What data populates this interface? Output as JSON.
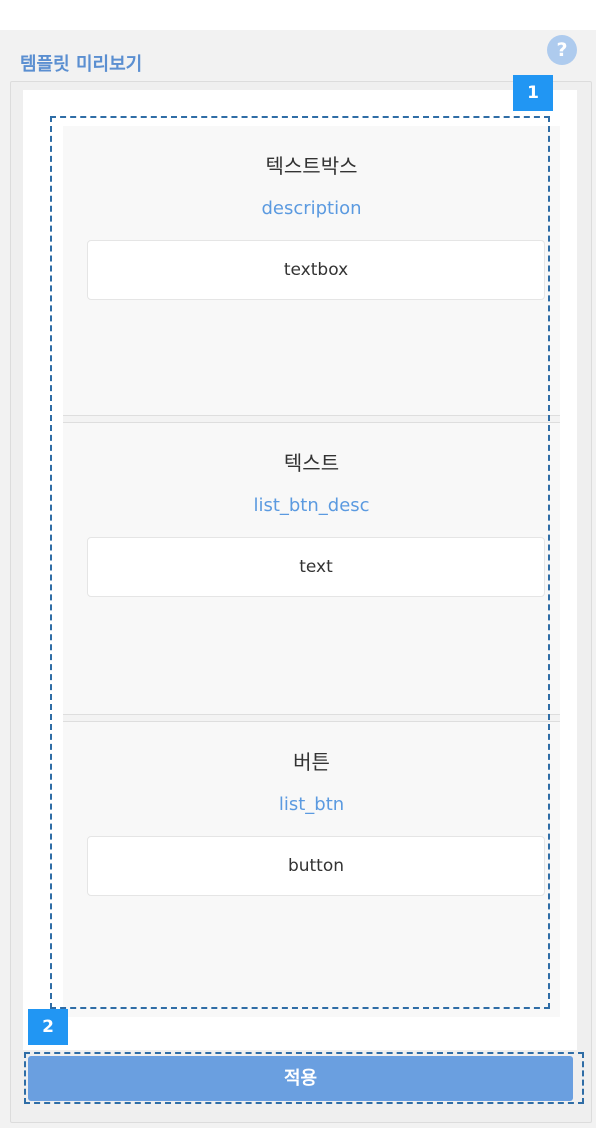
{
  "panel": {
    "title": "템플릿 미리보기",
    "help_icon": "question-mark-circle-icon",
    "help_symbol": "?"
  },
  "badges": [
    "1",
    "2"
  ],
  "templates": [
    {
      "title": "텍스트박스",
      "desc": "description",
      "box": "textbox"
    },
    {
      "title": "텍스트",
      "desc": "list_btn_desc",
      "box": "text"
    },
    {
      "title": "버튼",
      "desc": "list_btn",
      "box": "button"
    }
  ],
  "apply_button": {
    "label": "적용"
  },
  "colors": {
    "accent": "#5b8fd1",
    "desc_text": "#5b9ae0",
    "badge": "#2196f3",
    "button": "#6a9fe0",
    "dashed_outline": "#2f6da6"
  }
}
